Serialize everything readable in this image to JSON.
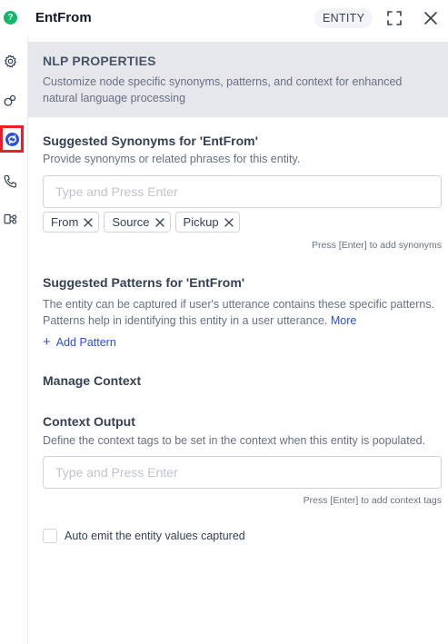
{
  "header": {
    "title": "EntFrom",
    "badge": "ENTITY",
    "logo_glyph": "?",
    "icons": [
      "logo-icon",
      "expand-icon",
      "close-icon"
    ]
  },
  "sidebar": {
    "items": [
      {
        "icon": "settings-gear-icon"
      },
      {
        "icon": "link-connections-icon"
      },
      {
        "icon": "nlp-properties-icon",
        "active": true
      },
      {
        "icon": "phone-icon"
      },
      {
        "icon": "flow-branch-icon"
      }
    ],
    "active_highlight_color": "#e5202a"
  },
  "banner": {
    "title": "NLP PROPERTIES",
    "description": "Customize node specific synonyms, patterns, and context for enhanced natural language processing"
  },
  "synonyms": {
    "title": "Suggested Synonyms for 'EntFrom'",
    "description": "Provide synonyms or related phrases for this entity.",
    "input_placeholder": "Type and Press Enter",
    "input_value": "",
    "chips": [
      "From",
      "Source",
      "Pickup"
    ],
    "hint": "Press [Enter] to add synonyms"
  },
  "patterns": {
    "title": "Suggested Patterns for 'EntFrom'",
    "description": "The entity can be captured if user's utterance contains these specific patterns. Patterns help in identifying this entity in a user utterance.",
    "more_link": "More",
    "add_label": "Add Pattern"
  },
  "context": {
    "title": "Manage Context",
    "output_title": "Context Output",
    "output_description": "Define the context tags to be set in the context when this entity is populated.",
    "input_placeholder": "Type and Press Enter",
    "input_value": "",
    "hint": "Press [Enter] to add context tags",
    "checkbox_label": "Auto emit the entity values captured",
    "checkbox_checked": false
  },
  "colors": {
    "accent": "#2b4fdc",
    "logo": "#12b76a",
    "banner_bg": "#e5e7eb"
  }
}
